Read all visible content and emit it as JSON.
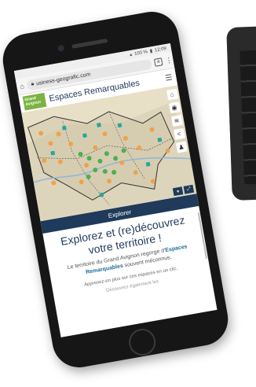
{
  "status_bar": {
    "time": "12:09",
    "battery": "100 %"
  },
  "browser": {
    "url": "usiness-geografic.com",
    "tab_count": "4",
    "menu_icon": "kebab-icon",
    "home_icon": "home-icon",
    "lock_icon": "lock-icon"
  },
  "site": {
    "logo_line1": "Grand",
    "logo_line2": "Avignon",
    "title": "Espaces Remarquables",
    "menu_icon": "hamburger-icon"
  },
  "map": {
    "tools": [
      "home-icon",
      "location-icon",
      "layers-icon",
      "share-icon",
      "person-icon"
    ],
    "controls": [
      "▾",
      "⤢"
    ],
    "colors": {
      "base": "#e8dfc7",
      "marker_green": "#4caf50",
      "marker_orange": "#f0a24b",
      "marker_teal": "#26a69a",
      "border": "#333333"
    }
  },
  "explore_bar": {
    "label": "Explorer"
  },
  "content": {
    "headline_line1": "Explorez et (re)découvrez",
    "headline_line2": "votre territoire !",
    "intro_part1": "Le territoire du Grand Avignon regorge d'",
    "intro_highlight": "Espaces Remarquables",
    "intro_part2": " souvent méconnus.",
    "subtext": "Apprenez-en plus sur ces espaces en un clic.",
    "subtext_faded": "Découvrez également les"
  },
  "colors": {
    "brand_navy": "#1f3a5a",
    "brand_green": "#7cb342",
    "link_blue": "#1f6b9a"
  }
}
